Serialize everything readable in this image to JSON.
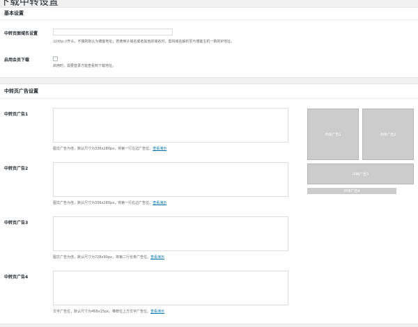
{
  "page_title": "下载中转设置",
  "basic": {
    "heading": "基本设置",
    "domain_label": "中转页面域名设置",
    "domain_value": "",
    "domain_desc": "以http://开头，不填则默认为博客地址；若使用子域名或者其他的域名时，需将域名解析至与博客主机一致的IP地址。",
    "member_label": "启用会员下载",
    "member_desc": "启用时，需要登录才能查看到下载地址。"
  },
  "ads": {
    "heading": "中转页广告设置",
    "demo_link": "查看演示",
    "items": [
      {
        "label": "中转页广告1",
        "value": "",
        "desc": "图文广告为佳，默认尺寸为336x280px，将第一行左边广告位。"
      },
      {
        "label": "中转页广告2",
        "value": "",
        "desc": "图文广告为佳，默认尺寸为336x280px，将第一行右边广告位。"
      },
      {
        "label": "中转页广告3",
        "value": "",
        "desc": "图文广告为佳，默认尺寸为728x90px，将第二行长条广告位。"
      },
      {
        "label": "中转页广告4",
        "value": "",
        "desc": "文字广告位，默认尺寸为468x15px，推荐位上方文字广告位。"
      }
    ],
    "preview": {
      "ad1": "中转广告1",
      "ad2": "中转广告2",
      "ad3": "中转广告3",
      "ad4": "中转广告4"
    }
  }
}
